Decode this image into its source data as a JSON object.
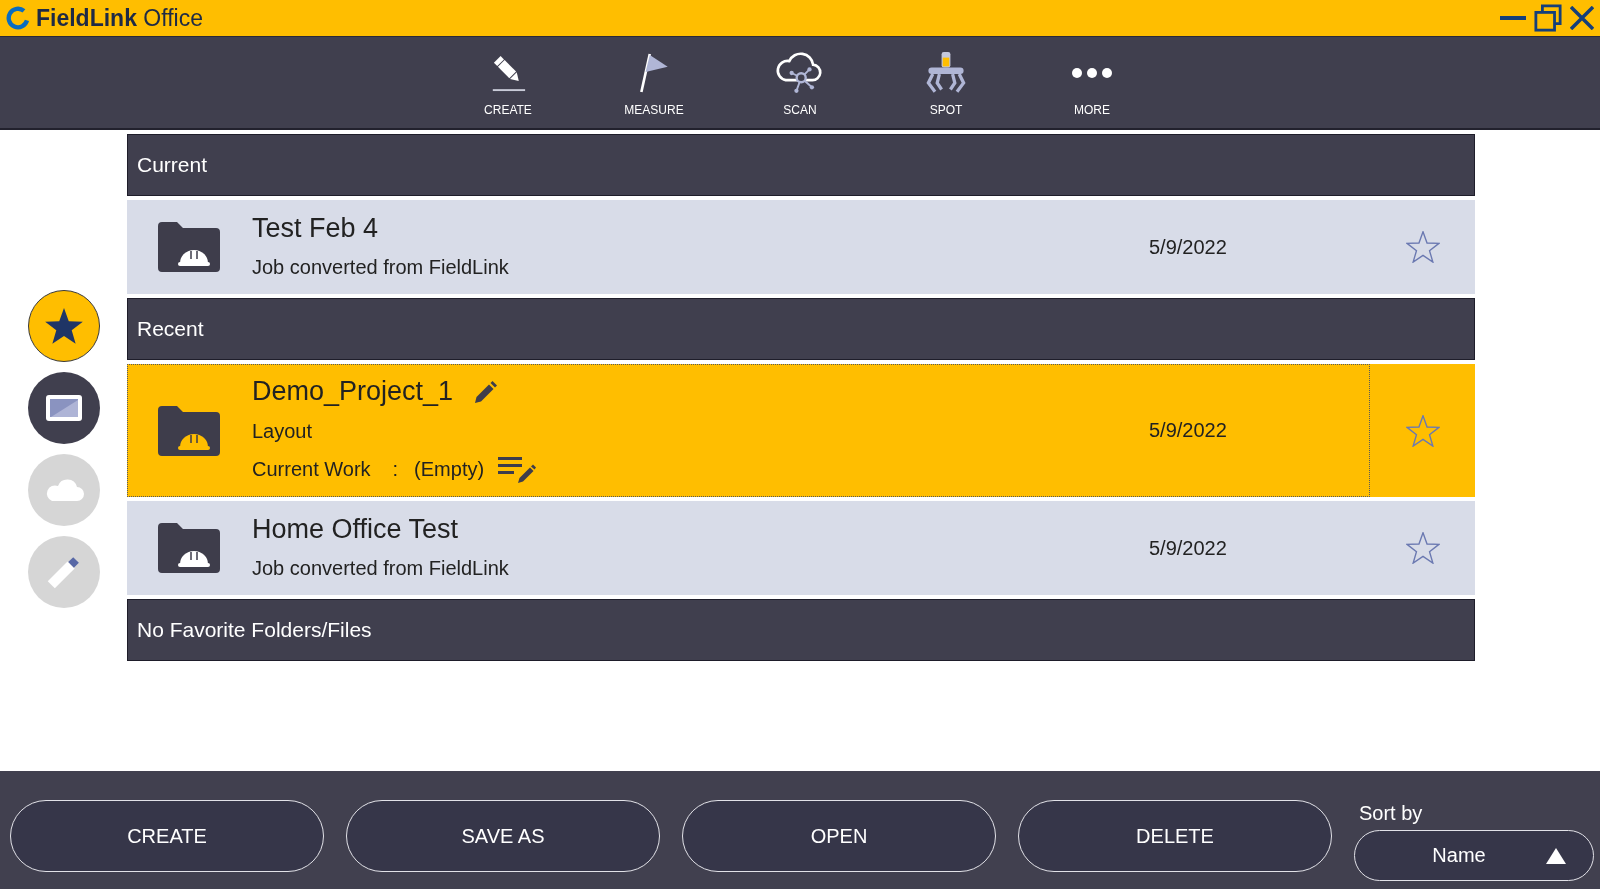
{
  "window": {
    "title": "**FieldLink** Office"
  },
  "toolbar": [
    "CREATE",
    "MEASURE",
    "SCAN",
    "SPOT",
    "MORE"
  ],
  "sidebar": [
    {
      "selected": true,
      "disabled": false
    },
    {
      "selected": false,
      "disabled": false
    },
    {
      "selected": false,
      "disabled": true
    },
    {
      "selected": false,
      "disabled": true
    }
  ],
  "sections": [
    {
      "title": "Current",
      "items": [
        {
          "name": "Test Feb 4",
          "description": "Job converted from FieldLink",
          "date": "5/9/2022",
          "selected": false,
          "favorite": false
        }
      ]
    },
    {
      "title": "Recent",
      "items": [
        {
          "name": "Demo_Project_1",
          "description": "Layout",
          "current_work": {
            "label": "Current Work",
            "separator": ":",
            "value": "(Empty)"
          },
          "date": "5/9/2022",
          "selected": true,
          "favorite": false
        },
        {
          "name": "Home Office Test",
          "description": "Job converted from FieldLink",
          "date": "5/9/2022",
          "selected": false,
          "favorite": false
        }
      ]
    },
    {
      "title": "No Favorite Folders/Files"
    }
  ],
  "actions": [
    "CREATE",
    "SAVE AS",
    "OPEN",
    "DELETE"
  ],
  "sort": {
    "label": "Sort by",
    "value": "Name"
  }
}
